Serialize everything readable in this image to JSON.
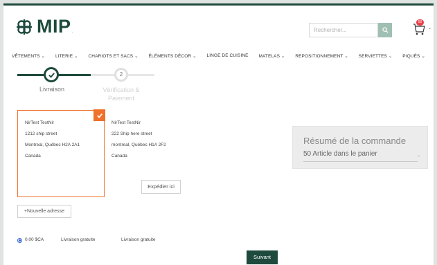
{
  "header": {
    "logo_text": "MIP",
    "logo_dot": ".",
    "search_placeholder": "Rechercher...",
    "cart_count": "50"
  },
  "nav": {
    "items": [
      {
        "label": "VÊTEMENTS ⌄"
      },
      {
        "label": "LITERIE ⌄"
      },
      {
        "label": "CHARIOTS ET SACS ⌄"
      },
      {
        "label": "ÉLÉMENTS DÉCOR ⌄"
      },
      {
        "label": "LINGE DE CUISINE"
      },
      {
        "label": "MATELAS ⌄"
      },
      {
        "label": "REPOSITIONNEMENT ⌄"
      },
      {
        "label": "SERVIETTES ⌄"
      },
      {
        "label": "PIQUÉS ⌄"
      }
    ]
  },
  "stepper": {
    "step1_label": "Livraison",
    "step2_number": "2",
    "step2_label_line1": "Vérification &",
    "step2_label_line2": "Paiement"
  },
  "addresses": [
    {
      "name": "NirTest TestNir",
      "street": "1212 ship street",
      "city": "Montreal, Québec H2A 2A1",
      "country": "Canada"
    },
    {
      "name": "NirTest TestNir",
      "street": "222 Ship here street",
      "city": "montreal, Québec H1A 2F2",
      "country": "Canada"
    }
  ],
  "ship_here_label": "Expédier ici",
  "new_address_label": "+Nouvelle adresse",
  "shipping": {
    "price": "0,00 $CA",
    "method": "Livraison gratuite",
    "carrier": "Livraison gratuite"
  },
  "next_label": "Suivant",
  "summary": {
    "title": "Résumé de la commande",
    "count": "50 Article dans le panier"
  },
  "colors": {
    "brand": "#1d4a3c",
    "accent": "#f0712b",
    "badge": "#e8404a",
    "radio": "#2e5ed8"
  },
  "icons": {
    "logo": "mip-logo-icon",
    "search": "search-icon",
    "cart": "cart-icon",
    "check": "check-icon"
  }
}
